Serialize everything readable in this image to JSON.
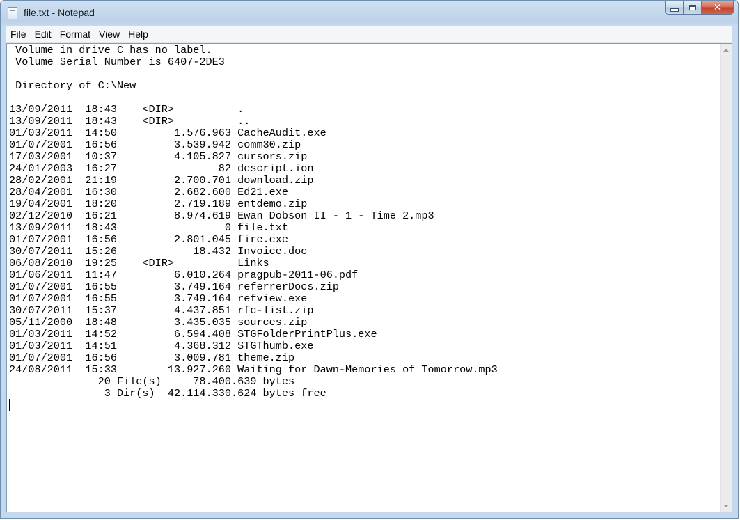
{
  "window": {
    "title": "file.txt - Notepad",
    "close_symbol": "✕"
  },
  "menu": [
    "File",
    "Edit",
    "Format",
    "View",
    "Help"
  ],
  "document": {
    "lines": [
      " Volume in drive C has no label.",
      " Volume Serial Number is 6407-2DE3",
      "",
      " Directory of C:\\New",
      "",
      "13/09/2011  18:43    <DIR>          .",
      "13/09/2011  18:43    <DIR>          ..",
      "01/03/2011  14:50         1.576.963 CacheAudit.exe",
      "01/07/2001  16:56         3.539.942 comm30.zip",
      "17/03/2001  10:37         4.105.827 cursors.zip",
      "24/01/2003  16:27                82 descript.ion",
      "28/02/2001  21:19         2.700.701 download.zip",
      "28/04/2001  16:30         2.682.600 Ed21.exe",
      "19/04/2001  18:20         2.719.189 entdemo.zip",
      "02/12/2010  16:21         8.974.619 Ewan Dobson II - 1 - Time 2.mp3",
      "13/09/2011  18:43                 0 file.txt",
      "01/07/2001  16:56         2.801.045 fire.exe",
      "30/07/2011  15:26            18.432 Invoice.doc",
      "06/08/2010  19:25    <DIR>          Links",
      "01/06/2011  11:47         6.010.264 pragpub-2011-06.pdf",
      "01/07/2001  16:55         3.749.164 referrerDocs.zip",
      "01/07/2001  16:55         3.749.164 refview.exe",
      "30/07/2011  15:37         4.437.851 rfc-list.zip",
      "05/11/2000  18:48         3.435.035 sources.zip",
      "01/03/2011  14:52         6.594.408 STGFolderPrintPlus.exe",
      "01/03/2011  14:51         4.368.312 STGThumb.exe",
      "01/07/2001  16:56         3.009.781 theme.zip",
      "24/08/2011  15:33        13.927.260 Waiting for Dawn-Memories of Tomorrow.mp3",
      "              20 File(s)     78.400.639 bytes",
      "               3 Dir(s)  42.114.330.624 bytes free"
    ]
  }
}
